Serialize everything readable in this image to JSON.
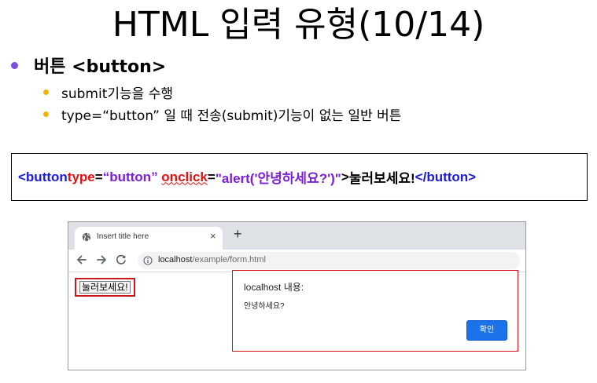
{
  "slide": {
    "title": "HTML 입력 유형(10/14)",
    "bullet_main": "버튼 <button>",
    "sub_bullets": [
      "submit기능을 수행",
      "type=“button” 일 때 전송(submit)기능이 없는 일반 버튼"
    ]
  },
  "code": {
    "open_tag_start": "<button ",
    "attr_type": "type",
    "eq1": "=",
    "type_value": "“button”",
    "space": " ",
    "attr_onclick": "onclick",
    "eq2": "=",
    "onclick_value": "\"alert('안녕하세요?')\"",
    "open_tag_end": ">",
    "content": "눌러보세요!",
    "close_tag": "</button>"
  },
  "browser": {
    "tab_title": "Insert title here",
    "tab_close": "×",
    "new_tab": "+",
    "url_host": "localhost",
    "url_path": "/example/form.html",
    "page_button_label": "눌러보세요!",
    "dialog": {
      "title": "localhost 내용:",
      "message": "안녕하세요?",
      "ok_label": "확인"
    }
  },
  "colors": {
    "tag": "#1a1adb",
    "attribute": "#e01010",
    "string": "#7a1fd6",
    "bullet_primary": "#7d4fe0",
    "bullet_secondary": "#f0b400",
    "highlight_border": "#d8141b",
    "dialog_button": "#1a73e8"
  },
  "icons": {
    "tab_favicon": "globe-icon",
    "back": "arrow-left-icon",
    "forward": "arrow-right-icon",
    "reload": "reload-icon",
    "site_info": "info-icon"
  }
}
